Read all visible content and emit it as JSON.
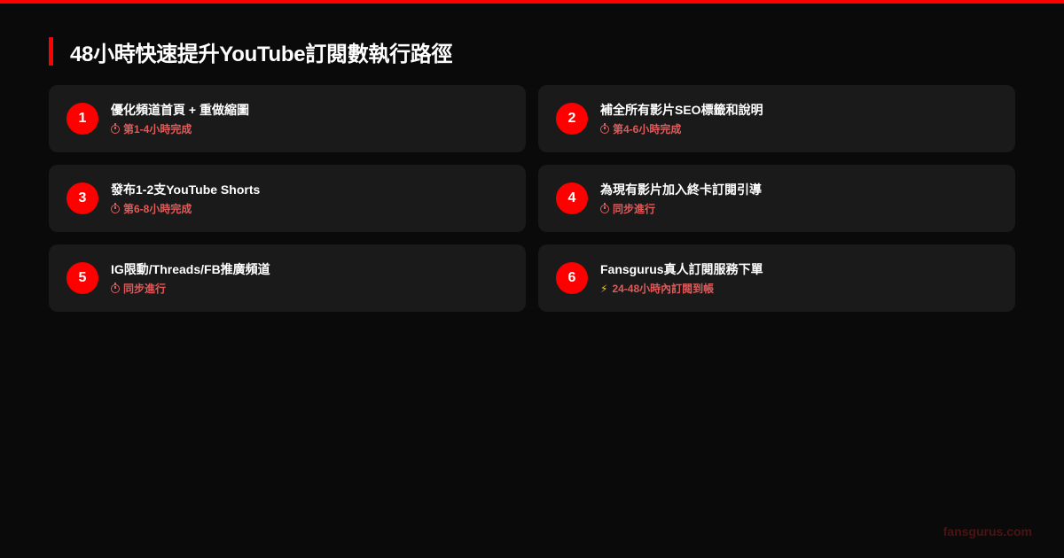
{
  "colors": {
    "accent": "#ff0000",
    "background": "#0a0a0a",
    "card": "#1a1a1a",
    "time_text": "#e05a5a",
    "footer_text": "#4a1414"
  },
  "title": "48小時快速提升YouTube訂閱數執行路徑",
  "steps": [
    {
      "number": "1",
      "title": "優化頻道首頁 + 重做縮圖",
      "time": "第1-4小時完成",
      "icon": "clock-icon"
    },
    {
      "number": "2",
      "title": "補全所有影片SEO標籤和說明",
      "time": "第4-6小時完成",
      "icon": "clock-icon"
    },
    {
      "number": "3",
      "title": "發布1-2支YouTube Shorts",
      "time": "第6-8小時完成",
      "icon": "clock-icon"
    },
    {
      "number": "4",
      "title": "為現有影片加入終卡訂閱引導",
      "time": "同步進行",
      "icon": "clock-icon"
    },
    {
      "number": "5",
      "title": "IG限動/Threads/FB推廣頻道",
      "time": "同步進行",
      "icon": "clock-icon"
    },
    {
      "number": "6",
      "title": "Fansgurus真人訂閱服務下單",
      "time": "24-48小時內訂閱到帳",
      "icon": "lightning-icon"
    }
  ],
  "footer": "fansgurus.com"
}
